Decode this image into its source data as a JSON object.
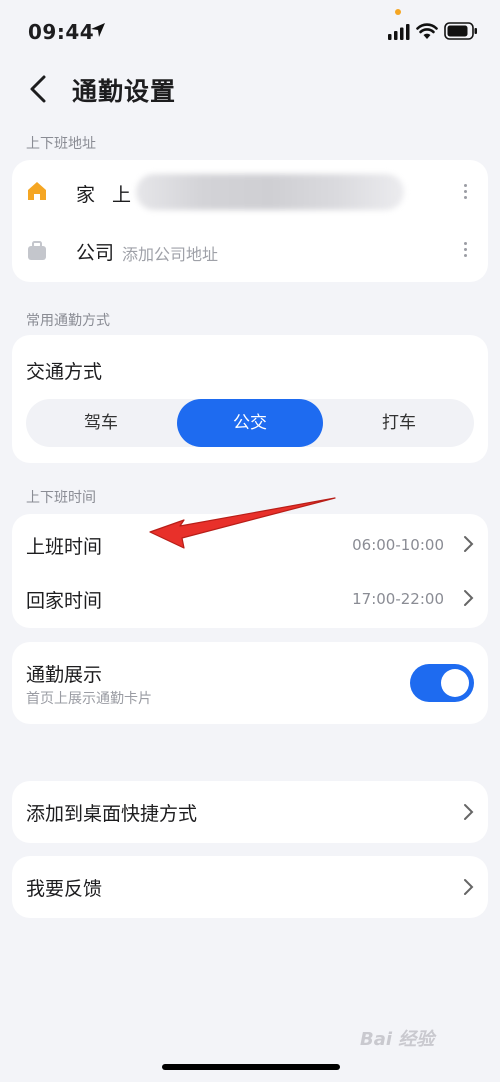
{
  "status_bar": {
    "time": "09:44"
  },
  "header": {
    "title": "通勤设置"
  },
  "address_section": {
    "label": "上下班地址",
    "home": {
      "label": "家",
      "value": "上"
    },
    "company": {
      "label": "公司",
      "placeholder": "添加公司地址"
    }
  },
  "commute_method_section": {
    "label": "常用通勤方式",
    "title": "交通方式",
    "options": [
      "驾车",
      "公交",
      "打车"
    ],
    "selected": "公交"
  },
  "time_section": {
    "label": "上下班时间",
    "rows": [
      {
        "label": "上班时间",
        "value": "06:00-10:00"
      },
      {
        "label": "回家时间",
        "value": "17:00-22:00"
      }
    ]
  },
  "display_section": {
    "title": "通勤展示",
    "subtitle": "首页上展示通勤卡片",
    "enabled": true
  },
  "shortcut": {
    "label": "添加到桌面快捷方式"
  },
  "feedback": {
    "label": "我要反馈"
  },
  "watermark": "Bai 经验",
  "colors": {
    "accent": "#1e6bf0",
    "home_icon": "#f5a623",
    "background": "#f3f4f8",
    "annotation_arrow": "#e8302a"
  }
}
